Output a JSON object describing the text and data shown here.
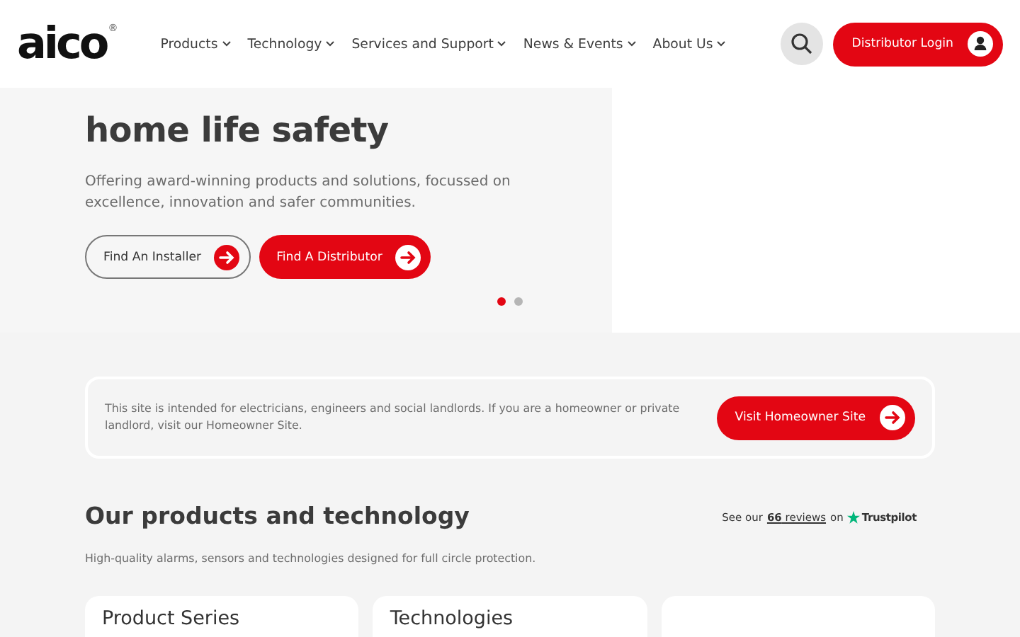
{
  "header": {
    "logo": "aico",
    "logo_mark": "®",
    "nav": [
      {
        "label": "Products"
      },
      {
        "label": "Technology"
      },
      {
        "label": "Services and Support"
      },
      {
        "label": "News & Events"
      },
      {
        "label": "About Us"
      }
    ],
    "login_button": "Distributor Login"
  },
  "hero": {
    "heading_lines": [
      "home life safety"
    ],
    "text": "Offering award-winning products and solutions, focussed on excellence, innovation and safer communities.",
    "buttons": [
      {
        "label": "Find An Installer",
        "kind": "outline"
      },
      {
        "label": "Find A Distributor",
        "kind": "filled"
      }
    ],
    "slides": [
      {
        "selected": true
      },
      {
        "selected": false
      }
    ]
  },
  "notice": {
    "text": "This site is intended for electricians, engineers and social landlords. If you are a homeowner or private landlord, visit our Homeowner Site.",
    "button": "Visit Homeowner Site"
  },
  "products": {
    "title": "Our products and technology",
    "reviews": {
      "prefix": "See our",
      "link": "**66** reviews",
      "suffix": "on",
      "brand": "Trustpilot"
    },
    "subtitle": "High-quality alarms, sensors and technologies designed for full circle protection.",
    "cards": [
      {
        "title": "Product Series"
      },
      {
        "title": "Technologies"
      }
    ]
  }
}
